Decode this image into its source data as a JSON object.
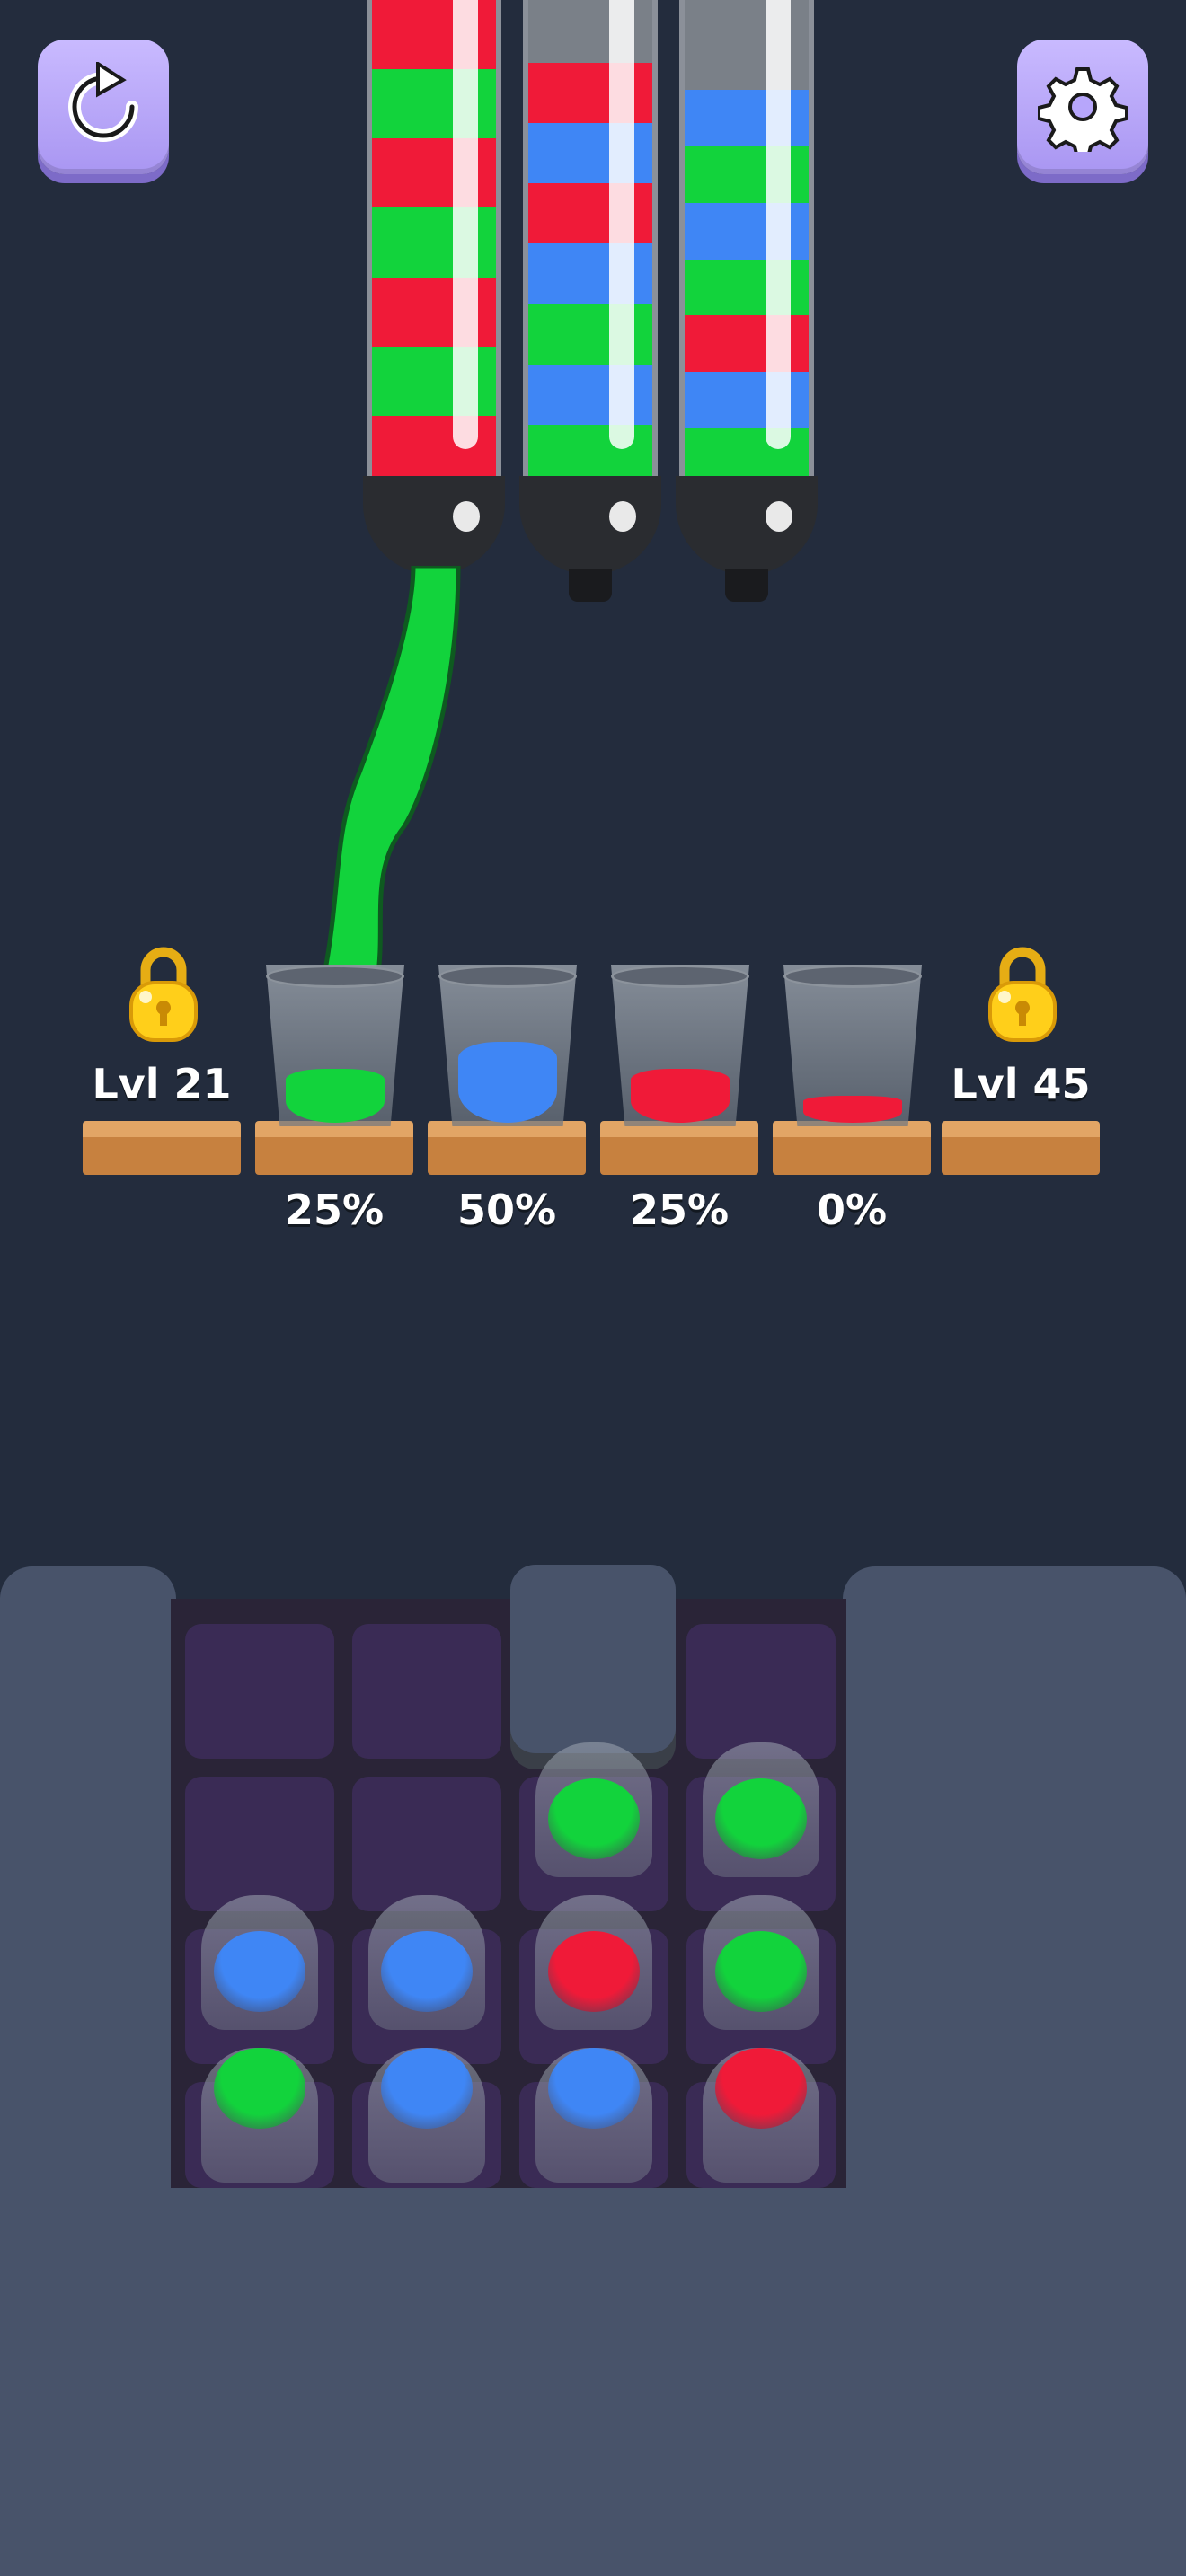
{
  "colors": {
    "background": "#232c3d",
    "button": "#b7a6fb",
    "green": "#12d33c",
    "blue": "#3f86f5",
    "red": "#f01a38",
    "wood": "#cf8c4a",
    "panel": "#48536a",
    "slot": "#3a2b55"
  },
  "toolbar": {
    "restart_icon": "restart-icon",
    "settings_icon": "gear-icon"
  },
  "tubes": [
    {
      "bands": [
        "red",
        "green",
        "red",
        "green",
        "red",
        "green",
        "red"
      ],
      "pouring": true
    },
    {
      "bands": [
        "red",
        "blue",
        "red",
        "blue",
        "green",
        "blue",
        "green"
      ],
      "pouring": false
    },
    {
      "bands": [
        "blue",
        "green",
        "blue",
        "green",
        "red",
        "blue",
        "green"
      ],
      "pouring": false
    }
  ],
  "locks": [
    {
      "label": "Lvl 21",
      "icon": "padlock-icon"
    },
    {
      "label": "Lvl 45",
      "icon": "padlock-icon"
    }
  ],
  "cups": [
    {
      "color": "green",
      "percent": "25%"
    },
    {
      "color": "blue",
      "percent": "50%"
    },
    {
      "color": "red",
      "percent": "25%"
    },
    {
      "color": "red",
      "percent": "0%"
    }
  ],
  "tray": {
    "columns": [
      {
        "cups": [
          "green",
          "blue"
        ]
      },
      {
        "cups": [
          "blue",
          "blue"
        ]
      },
      {
        "cups": [
          "blue",
          "red",
          "green"
        ]
      },
      {
        "cups": [
          "red",
          "green",
          "green"
        ]
      }
    ]
  }
}
